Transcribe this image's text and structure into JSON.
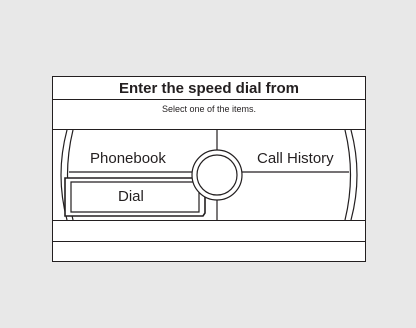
{
  "screen": {
    "title": "Enter the speed dial from",
    "subtitle": "Select one of the items."
  },
  "menu": {
    "items": [
      {
        "label": "Phonebook",
        "selected": false
      },
      {
        "label": "Call History",
        "selected": false
      },
      {
        "label": "Dial",
        "selected": true
      }
    ]
  },
  "colors": {
    "background": "#e8e8e8",
    "screen": "#ffffff",
    "line": "#231f20"
  }
}
